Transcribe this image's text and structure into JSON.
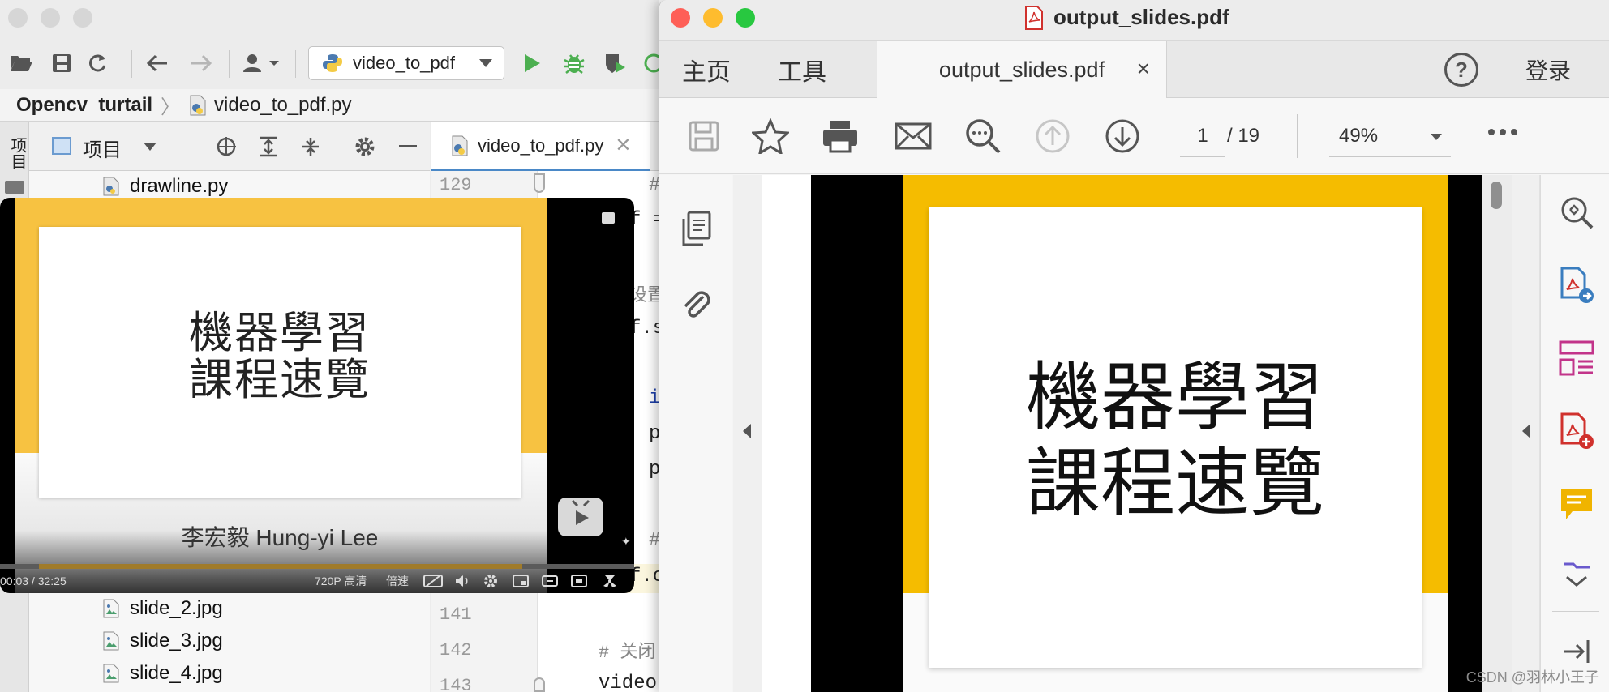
{
  "ide": {
    "run_config": "video_to_pdf",
    "breadcrumb": {
      "project": "Opencv_turtail",
      "file": "video_to_pdf.py"
    },
    "side_tab": "项目",
    "project_panel_title": "项目",
    "editor_tab": "video_to_pdf.py",
    "tree_items": [
      "drawline.py",
      "slide_2.jpg",
      "slide_3.jpg",
      "slide_4.jpg"
    ],
    "line_numbers": {
      "top": "129",
      "a": "141",
      "b": "142",
      "c": "143"
    },
    "code": {
      "l0": "#",
      "l1": "f =",
      "l2": "设置",
      "l3": "f.s",
      "l4": "i",
      "l5": "p",
      "l6": "p",
      "l7": "#",
      "l8": "f.c",
      "l9": "# 关闭",
      "l10": "video."
    }
  },
  "video": {
    "slide_title_line1": "機器學習",
    "slide_title_line2": "課程速覽",
    "author": "李宏毅 Hung-yi Lee",
    "time": "00:03 / 32:25",
    "quality": "720P 高清",
    "speed": "倍速",
    "progress_fraction": 0.002
  },
  "pdf": {
    "window_title": "output_slides.pdf",
    "tabs": {
      "home": "主页",
      "tools": "工具"
    },
    "doc_tab": "output_slides.pdf",
    "doc_tab_close": "×",
    "login": "登录",
    "page_current": "1",
    "page_total": "/ 19",
    "zoom": "49%",
    "slide_title_line1": "機器學習",
    "slide_title_line2": "課程速覽"
  },
  "watermark": "CSDN @羽林小王子",
  "colors": {
    "slide_yellow": "#f5bc00",
    "video_yellow": "#f7c241",
    "run_green": "#4caf50",
    "mac_red": "#fe5f57",
    "mac_yellow": "#febc2e",
    "mac_green": "#28c840"
  }
}
